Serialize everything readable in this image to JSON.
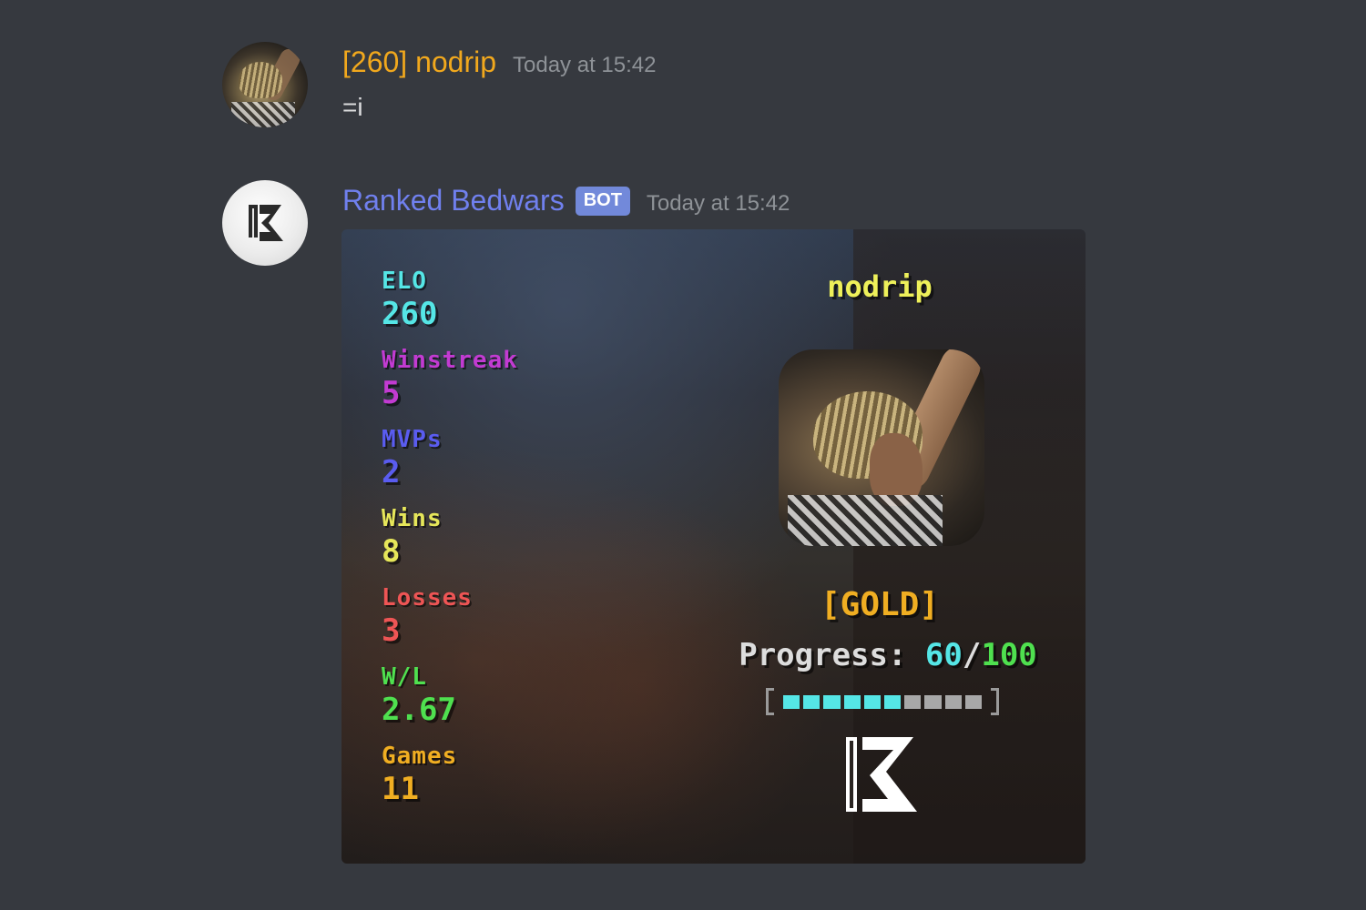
{
  "messages": [
    {
      "username": "[260] nodrip",
      "timestamp": "Today at 15:42",
      "content": "=i",
      "avatar_icon": "user-photo-avatar"
    },
    {
      "username": "Ranked Bedwars",
      "bot_tag": "BOT",
      "timestamp": "Today at 15:42",
      "avatar_icon": "ranked-bedwars-logo",
      "stats_card": {
        "player_name": "nodrip",
        "stats": [
          {
            "label": "ELO",
            "value": "260"
          },
          {
            "label": "Winstreak",
            "value": "5"
          },
          {
            "label": "MVPs",
            "value": "2"
          },
          {
            "label": "Wins",
            "value": "8"
          },
          {
            "label": "Losses",
            "value": "3"
          },
          {
            "label": "W/L",
            "value": "2.67"
          },
          {
            "label": "Games",
            "value": "11"
          }
        ],
        "rank": "[GOLD]",
        "progress_label": "Progress: ",
        "progress_current": "60",
        "progress_separator": "/",
        "progress_max": "100",
        "progress_fraction": 0.6,
        "progress_segments_total": 10,
        "progress_segments_filled": 6
      }
    }
  ],
  "colors": {
    "background": "#36393f",
    "user_name": "#f1a81d",
    "bot_name": "#7080ee",
    "bot_tag": "#7289da",
    "timestamp": "#8e9297",
    "elo": "#55e6e6",
    "winstreak": "#c23bd2",
    "mvps": "#5a5cf0",
    "wins": "#e6e65a",
    "losses": "#ee5555",
    "wl": "#4fe04f",
    "games": "#f0ae22"
  }
}
